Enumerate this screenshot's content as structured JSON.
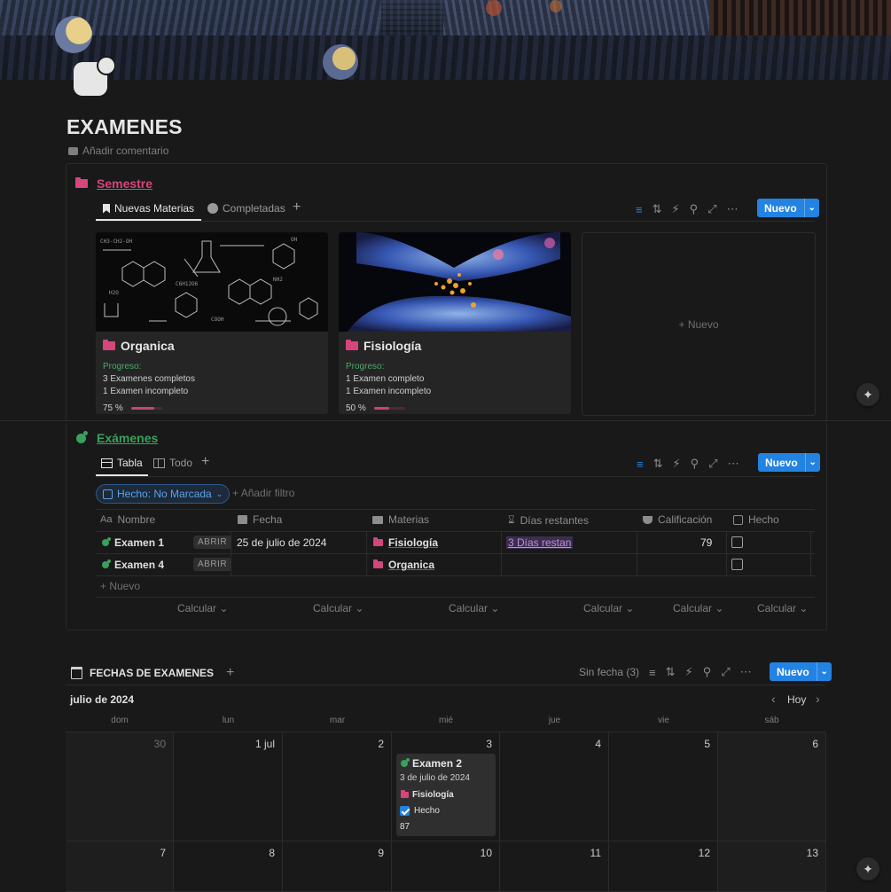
{
  "page": {
    "title": "EXAMENES",
    "comment_label": "Añadir comentario"
  },
  "semestre": {
    "title": "Semestre",
    "tabs": [
      {
        "label": "Nuevas Materias",
        "active": true
      },
      {
        "label": "Completadas",
        "active": false
      }
    ],
    "new_button": "Nuevo",
    "cards": [
      {
        "title": "Organica",
        "progress_label": "Progreso:",
        "line1": "3 Examenes completos",
        "line2": "1 Examen incompleto",
        "percent_text": "75 %",
        "progress": 0.75
      },
      {
        "title": "Fisiología",
        "progress_label": "Progreso:",
        "line1": "1 Examen completo",
        "line2": "1 Examen incompleto",
        "percent_text": "50 %",
        "progress": 0.5
      }
    ],
    "add_card_label": "+ Nuevo"
  },
  "examenes": {
    "title": "Exámenes",
    "tabs": [
      {
        "label": "Tabla",
        "active": true
      },
      {
        "label": "Todo",
        "active": false
      }
    ],
    "new_button": "Nuevo",
    "filter_chip": "Hecho: No Marcada",
    "add_filter": "Añadir filtro",
    "columns": [
      "Nombre",
      "Fecha",
      "Materias",
      "Días restantes",
      "Calificación",
      "Hecho"
    ],
    "open_label": "ABRIR",
    "rows": [
      {
        "name": "Examen 1",
        "fecha": "25 de julio de 2024",
        "materia": "Fisiología",
        "dias": "3 Días restan",
        "calificacion": "79",
        "hecho": false
      },
      {
        "name": "Examen 4",
        "fecha": "",
        "materia": "Organica",
        "dias": "",
        "calificacion": "",
        "hecho": false
      }
    ],
    "add_row": "Nuevo",
    "calc_label": "Calcular"
  },
  "calendar": {
    "title": "FECHAS DE EXAMENES",
    "sin_fecha": "Sin fecha (3)",
    "new_button": "Nuevo",
    "month": "julio de 2024",
    "today_label": "Hoy",
    "weekdays": [
      "dom",
      "lun",
      "mar",
      "mié",
      "jue",
      "vie",
      "sáb"
    ],
    "week1": [
      "30",
      "1 jul",
      "2",
      "3",
      "4",
      "5",
      "6"
    ],
    "week2": [
      "7",
      "8",
      "9",
      "10",
      "11",
      "12",
      "13"
    ],
    "event": {
      "title": "Examen 2",
      "date": "3 de julio de 2024",
      "materia": "Fisiología",
      "hecho_label": "Hecho",
      "hecho": true,
      "score": "87"
    }
  },
  "colors": {
    "accent": "#2383e2",
    "pink": "#d6457c",
    "green": "#3aa05b",
    "background": "#191919"
  }
}
